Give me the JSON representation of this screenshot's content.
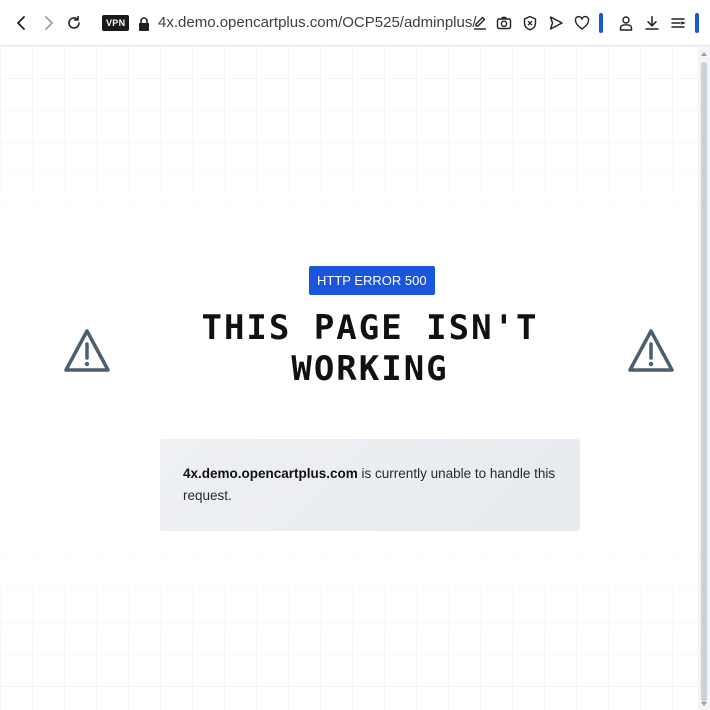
{
  "browser": {
    "vpn_label": "VPN",
    "url": "4x.demo.opencartplus.com/OCP525/adminplus/",
    "icons": [
      "back-icon",
      "forward-icon",
      "reload-icon",
      "lock-icon",
      "edit-icon",
      "camera-icon",
      "shield-icon",
      "send-icon",
      "heart-icon",
      "account-icon",
      "download-icon",
      "menu-icon"
    ],
    "accent_color": "#1a56db"
  },
  "error": {
    "badge": "HTTP ERROR 500",
    "title": "THIS PAGE ISN'T WORKING",
    "host": "4x.demo.opencartplus.com",
    "message": " is currently unable to handle this request.",
    "badge_color": "#1a56db",
    "icon_color": "#4b5f6e"
  }
}
